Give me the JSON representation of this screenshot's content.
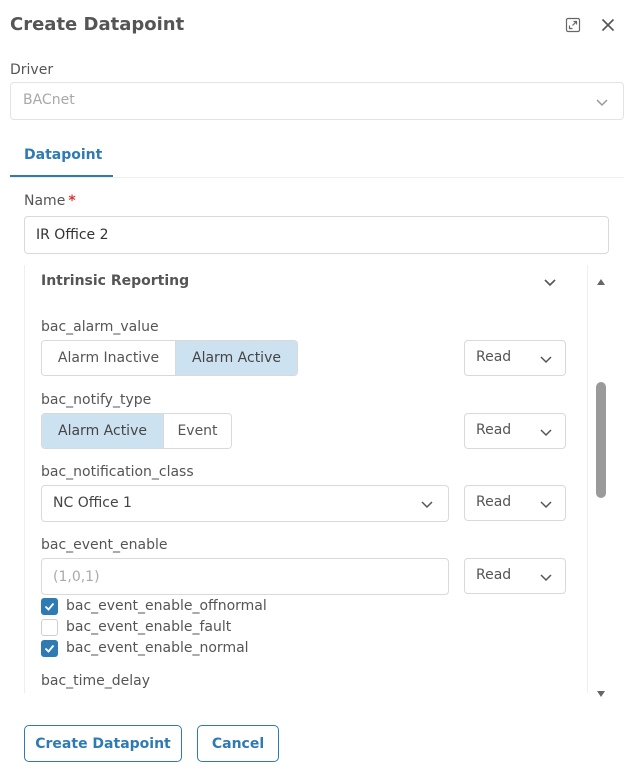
{
  "dialog": {
    "title": "Create Datapoint",
    "icons": {
      "expand": "expand-icon",
      "close": "close-icon"
    }
  },
  "driver": {
    "label": "Driver",
    "value": "BACnet"
  },
  "tabs": [
    {
      "label": "Datapoint",
      "active": true
    }
  ],
  "name_field": {
    "label": "Name",
    "required_mark": "*",
    "value": "IR Office 2"
  },
  "section": {
    "title": "Intrinsic Reporting",
    "fields": {
      "alarm_value": {
        "label": "bac_alarm_value",
        "options": [
          {
            "label": "Alarm Inactive",
            "active": false
          },
          {
            "label": "Alarm Active",
            "active": true
          }
        ],
        "access": "Read"
      },
      "notify_type": {
        "label": "bac_notify_type",
        "options": [
          {
            "label": "Alarm Active",
            "active": true
          },
          {
            "label": "Event",
            "active": false
          }
        ],
        "access": "Read"
      },
      "notification_class": {
        "label": "bac_notification_class",
        "value": "NC Office 1",
        "access": "Read"
      },
      "event_enable": {
        "label": "bac_event_enable",
        "placeholder": "(1,0,1)",
        "access": "Read",
        "checks": [
          {
            "label": "bac_event_enable_offnormal",
            "checked": true
          },
          {
            "label": "bac_event_enable_fault",
            "checked": false
          },
          {
            "label": "bac_event_enable_normal",
            "checked": true
          }
        ]
      },
      "time_delay": {
        "label": "bac_time_delay"
      }
    }
  },
  "buttons": {
    "create": "Create Datapoint",
    "cancel": "Cancel"
  },
  "colors": {
    "accent": "#2e7bb4",
    "segment_active": "#cde2f0",
    "required": "#d83333"
  }
}
